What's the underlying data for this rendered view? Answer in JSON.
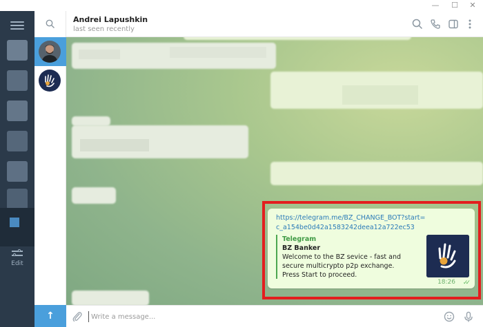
{
  "window": {
    "controls": {
      "minimize": "—",
      "maximize": "☐",
      "close": "✕"
    }
  },
  "sidebar": {
    "menu_icon": "hamburger-icon",
    "edit_label": "Edit"
  },
  "chat_list": {
    "search_icon": "search-icon",
    "compose_icon": "arrow-up-icon",
    "compose_symbol": "↑"
  },
  "header": {
    "name": "Andrei Lapushkin",
    "status": "last seen recently",
    "icons": [
      "search-icon",
      "phone-icon",
      "sidebar-toggle-icon",
      "more-vertical-icon"
    ]
  },
  "message": {
    "link": "https://telegram.me/BZ_CHANGE_BOT?start=c_a154be0d42a1583242deea12a722ec53",
    "preview": {
      "site": "Telegram",
      "title": "BZ Banker",
      "description": "Welcome to the BZ sevice - fast and secure multicrypto p2p exchange. Press Start to proceed."
    },
    "time": "18:26",
    "status_icon": "double-check-icon",
    "status_symbol": "✓✓",
    "highlight_color": "#e31e1e"
  },
  "composer": {
    "placeholder": "Write a message...",
    "icons": [
      "paperclip-icon",
      "emoji-icon",
      "microphone-icon"
    ]
  },
  "colors": {
    "accent": "#4a9fdc",
    "sidebar_bg": "#2b3a4a",
    "outgoing_bubble": "#effdde",
    "link": "#2a7ab8",
    "preview_accent": "#4ca750"
  }
}
